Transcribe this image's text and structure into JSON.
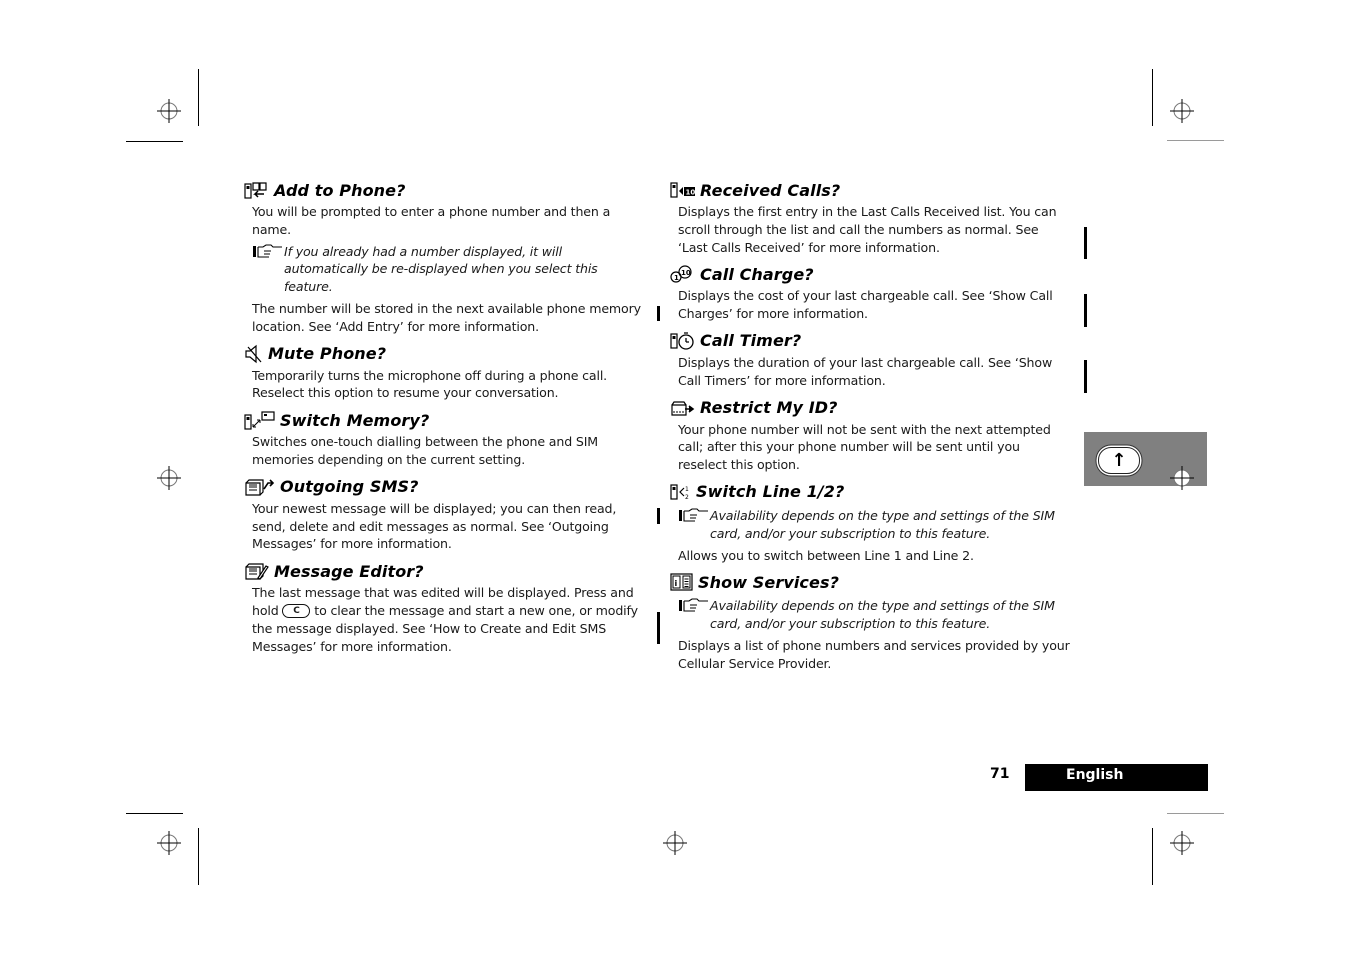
{
  "page": {
    "page_number": "71",
    "language_tab": "English",
    "side_tab_button": {
      "icon": "up-arrow-icon",
      "glyph": "↑"
    }
  },
  "icons": {
    "note_hand": "pointing-hand-note-icon"
  },
  "left_column": [
    {
      "icon": "phone-add-book-icon",
      "title": "Add to Phone?",
      "paragraphs": [
        "You will be prompted to enter a phone number and then a name."
      ],
      "note": "If you already had a number displayed, it will automatically be re-displayed when you select this feature.",
      "after_note": "The number will be stored in the next available phone memory location. See ‘Add Entry’ for more information."
    },
    {
      "icon": "mute-speaker-icon",
      "title": "Mute Phone?",
      "paragraphs": [
        "Temporarily turns the microphone off during a phone call. Reselect this option to resume your conversation."
      ]
    },
    {
      "icon": "switch-memory-icon",
      "title": "Switch Memory?",
      "paragraphs": [
        "Switches one-touch dialling between the phone and SIM memories depending on the current setting."
      ]
    },
    {
      "icon": "outgoing-sms-icon",
      "title": "Outgoing SMS?",
      "paragraphs": [
        "Your newest message will be displayed; you can then read, send, delete and edit messages as normal. See ‘Outgoing Messages’ for more information."
      ]
    },
    {
      "icon": "message-editor-icon",
      "title": "Message Editor?",
      "paragraph_parts": {
        "before_key": "The last message that was edited will be displayed. Press and hold ",
        "key_label": "C",
        "after_key": " to clear the message and start a new one, or modify the message displayed. See ‘How to Create and Edit SMS Messages’ for more information."
      }
    }
  ],
  "right_column": [
    {
      "icon": "received-calls-icon",
      "title": "Received Calls?",
      "paragraphs": [
        "Displays the first entry in the Last Calls Received list. You can scroll through the list and call the numbers as normal. See ‘Last Calls Received’ for more information."
      ]
    },
    {
      "icon": "call-charge-icon",
      "title": "Call Charge?",
      "paragraphs": [
        "Displays the cost of your last chargeable call. See ‘Show Call Charges’ for more information."
      ]
    },
    {
      "icon": "call-timer-icon",
      "title": "Call Timer?",
      "paragraphs": [
        "Displays the duration of your last chargeable call. See ‘Show Call Timers’ for more information."
      ]
    },
    {
      "icon": "restrict-id-icon",
      "title": "Restrict My ID?",
      "paragraphs": [
        "Your phone number will not be sent with the next attempted call; after this your phone number will be sent until you reselect this option."
      ]
    },
    {
      "icon": "switch-line-icon",
      "title": "Switch Line 1/2?",
      "note": "Availability depends on the type and settings of the SIM card, and/or your subscription to this feature.",
      "after_note": "Allows you to switch between Line 1 and Line 2."
    },
    {
      "icon": "show-services-icon",
      "title": "Show Services?",
      "note": "Availability depends on the type and settings of the SIM card, and/or your subscription to this feature.",
      "after_note": "Displays a list of phone numbers and services provided by your Cellular Service Provider."
    }
  ]
}
